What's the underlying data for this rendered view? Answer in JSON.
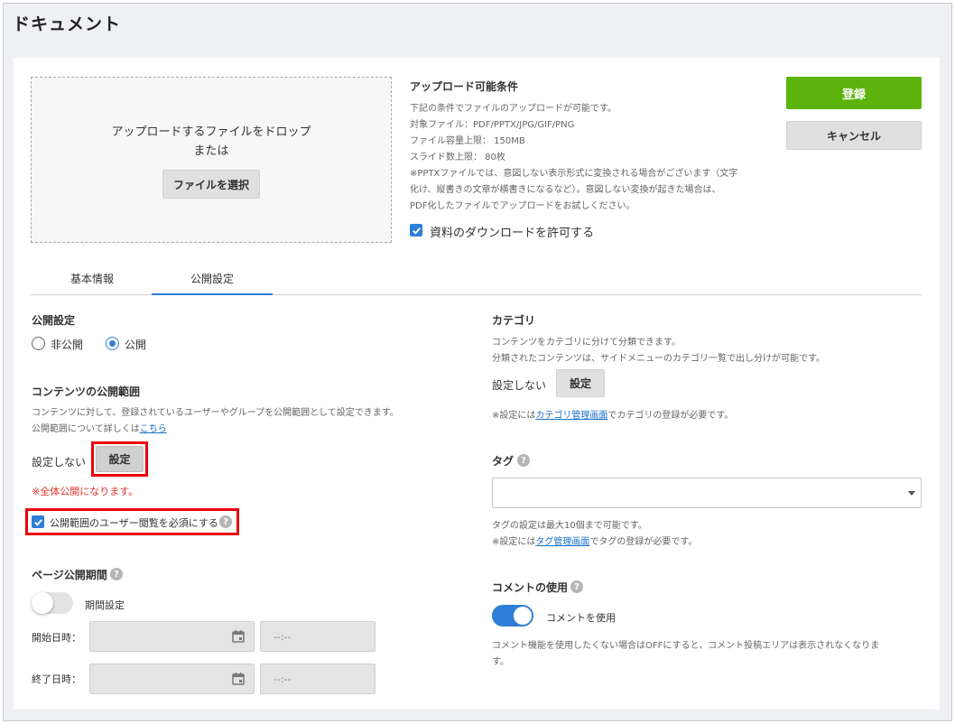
{
  "page": {
    "title": "ドキュメント"
  },
  "upload": {
    "drop_text": "アップロードするファイルをドロップ",
    "or_text": "または",
    "select_button": "ファイルを選択"
  },
  "conditions": {
    "title": "アップロード可能条件",
    "lines": [
      "下記の条件でファイルのアップロードが可能です。",
      "対象ファイル：PDF/PPTX/JPG/GIF/PNG",
      "ファイル容量上限： 150MB",
      "スライド数上限： 80枚",
      "※PPTXファイルでは、意図しない表示形式に変換される場合がございます（文字",
      "化け、縦書きの文章が横書きになるなど）。意図しない変換が起きた場合は、",
      "PDF化したファイルでアップロードをお試しください。"
    ],
    "download_checkbox": {
      "label": "資料のダウンロードを許可する",
      "checked": true
    }
  },
  "actions": {
    "register": "登録",
    "cancel": "キャンセル"
  },
  "tabs": [
    {
      "label": "基本情報",
      "active": false
    },
    {
      "label": "公開設定",
      "active": true
    }
  ],
  "publish": {
    "label": "公開設定",
    "options": [
      {
        "label": "非公開",
        "selected": false
      },
      {
        "label": "公開",
        "selected": true
      }
    ]
  },
  "scope": {
    "label": "コンテンツの公開範囲",
    "desc1": "コンテンツに対して、登録されているユーザーやグループを公開範囲として設定できます。",
    "desc2_prefix": "公開範囲について詳しくは",
    "desc2_link": "こちら",
    "status": "設定しない",
    "button": "設定",
    "warning": "※全体公開になります。",
    "required_checkbox": {
      "label": "公開範囲のユーザー閲覧を必須にする",
      "checked": true
    }
  },
  "period": {
    "label": "ページ公開期間",
    "toggle_label": "期間設定",
    "toggle_on": false,
    "start_label": "開始日時：",
    "end_label": "終了日時：",
    "time_placeholder": "--:--"
  },
  "category": {
    "label": "カテゴリ",
    "desc1": "コンテンツをカテゴリに分けて分類できます。",
    "desc2": "分類されたコンテンツは、サイドメニューのカテゴリ一覧で出し分けが可能です。",
    "status": "設定しない",
    "button": "設定",
    "note_prefix": "※設定には",
    "note_link": "カテゴリ管理画面",
    "note_suffix": "でカテゴリの登録が必要です。"
  },
  "tag": {
    "label": "タグ",
    "note1": "タグの設定は最大10個まで可能です。",
    "note2_prefix": "※設定には",
    "note2_link": "タグ管理画面",
    "note2_suffix": "でタグの登録が必要です。"
  },
  "comment": {
    "label": "コメントの使用",
    "toggle_label": "コメントを使用",
    "toggle_on": true,
    "desc1": "コメント機能を使用したくない場合はOFFにすると、コメント投稿エリアは表示されなくなりま",
    "desc2": "す。"
  },
  "colors": {
    "accent": "#2f7fd6",
    "register_green": "#5cb30b",
    "highlight_red": "#e8000d",
    "warning_red": "#e0332b"
  }
}
